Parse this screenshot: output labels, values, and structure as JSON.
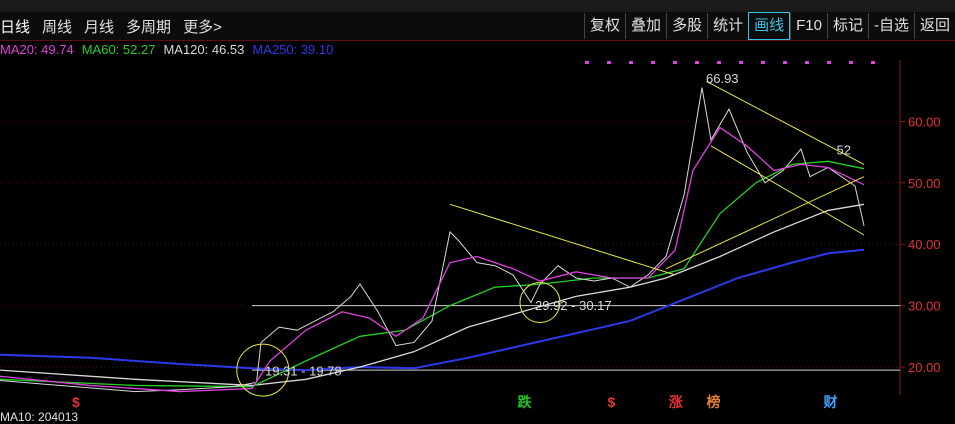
{
  "toolbar": {
    "left_items": [
      "日线",
      "周线",
      "月线",
      "多周期",
      "更多>"
    ],
    "right_items": [
      "复权",
      "叠加",
      "多股",
      "统计",
      "画线",
      "F10",
      "标记",
      "-自选",
      "返回"
    ],
    "active_right": "画线"
  },
  "ma_legend": [
    {
      "label": "MA20: 49.74",
      "color": "#e040e0"
    },
    {
      "label": "MA60: 52.27",
      "color": "#22d022"
    },
    {
      "label": "MA120: 46.53",
      "color": "#d8d8d8"
    },
    {
      "label": "MA250: 39.10",
      "color": "#2a3ae8"
    }
  ],
  "bottom_label": "MA10: 204013",
  "chart_data": {
    "type": "line",
    "y_axis": {
      "ticks": [
        20.0,
        30.0,
        40.0,
        50.0,
        60.0
      ],
      "min": 13,
      "max": 70,
      "side": "right"
    },
    "annotations": [
      {
        "text": "66.93",
        "at": [
          0.78,
          66.93
        ]
      },
      {
        "text": "29.92 - 30.17",
        "at": [
          0.59,
          29.92
        ]
      },
      {
        "text": "19.31 - 19.78",
        "at": [
          0.29,
          19.31
        ]
      },
      {
        "text": "52",
        "at": [
          0.925,
          55.3
        ]
      }
    ],
    "horizontal_lines": [
      19.5,
      30.0
    ],
    "event_markers": [
      {
        "text": "$",
        "pos": 0.08,
        "color": "#e83030"
      },
      {
        "text": "跌",
        "pos": 0.575,
        "color": "#22c422"
      },
      {
        "text": "$",
        "pos": 0.675,
        "color": "#e83030"
      },
      {
        "text": "涨",
        "pos": 0.743,
        "color": "#e83030"
      },
      {
        "text": "榜",
        "pos": 0.785,
        "color": "#e08030"
      },
      {
        "text": "财",
        "pos": 0.915,
        "color": "#3aa0ff"
      }
    ],
    "colors": {
      "axis": "#8b1a1a",
      "tick_label": "#e03030",
      "ma20": "#e040e0",
      "ma60": "#22d022",
      "ma120": "#d8d8d8",
      "ma250": "#2a3ae8",
      "trend": "#e8e840",
      "price": "#d8d8d8"
    },
    "price_path": [
      [
        0,
        17.8
      ],
      [
        0.05,
        17.2
      ],
      [
        0.1,
        16.6
      ],
      [
        0.15,
        16.0
      ],
      [
        0.2,
        16.3
      ],
      [
        0.26,
        16.8
      ],
      [
        0.285,
        17.5
      ],
      [
        0.29,
        24.0
      ],
      [
        0.31,
        26.5
      ],
      [
        0.33,
        26.0
      ],
      [
        0.35,
        27.5
      ],
      [
        0.37,
        29.0
      ],
      [
        0.39,
        31.5
      ],
      [
        0.4,
        33.5
      ],
      [
        0.42,
        29.0
      ],
      [
        0.44,
        23.5
      ],
      [
        0.46,
        24.0
      ],
      [
        0.48,
        27.5
      ],
      [
        0.5,
        42.0
      ],
      [
        0.51,
        40.5
      ],
      [
        0.53,
        37.0
      ],
      [
        0.55,
        36.5
      ],
      [
        0.57,
        35.0
      ],
      [
        0.59,
        30.5
      ],
      [
        0.6,
        33.5
      ],
      [
        0.62,
        36.5
      ],
      [
        0.64,
        34.5
      ],
      [
        0.66,
        34.0
      ],
      [
        0.68,
        34.5
      ],
      [
        0.7,
        33.0
      ],
      [
        0.72,
        35.0
      ],
      [
        0.74,
        38.0
      ],
      [
        0.76,
        48.0
      ],
      [
        0.78,
        65.5
      ],
      [
        0.79,
        57.0
      ],
      [
        0.81,
        62.0
      ],
      [
        0.83,
        55.0
      ],
      [
        0.85,
        50.0
      ],
      [
        0.87,
        52.0
      ],
      [
        0.89,
        55.5
      ],
      [
        0.9,
        51.0
      ],
      [
        0.92,
        52.5
      ],
      [
        0.94,
        50.5
      ],
      [
        0.95,
        49.5
      ],
      [
        0.96,
        43.0
      ]
    ],
    "ma20_path": [
      [
        0,
        18.5
      ],
      [
        0.1,
        17.0
      ],
      [
        0.2,
        16.0
      ],
      [
        0.28,
        16.5
      ],
      [
        0.3,
        21.0
      ],
      [
        0.34,
        26.0
      ],
      [
        0.38,
        29.0
      ],
      [
        0.41,
        28.0
      ],
      [
        0.44,
        25.0
      ],
      [
        0.47,
        28.0
      ],
      [
        0.5,
        37.0
      ],
      [
        0.53,
        38.0
      ],
      [
        0.57,
        36.0
      ],
      [
        0.6,
        34.0
      ],
      [
        0.64,
        35.5
      ],
      [
        0.68,
        34.5
      ],
      [
        0.72,
        34.5
      ],
      [
        0.75,
        39.0
      ],
      [
        0.77,
        52.0
      ],
      [
        0.8,
        59.0
      ],
      [
        0.83,
        56.0
      ],
      [
        0.86,
        52.0
      ],
      [
        0.89,
        53.0
      ],
      [
        0.92,
        52.5
      ],
      [
        0.96,
        49.7
      ]
    ],
    "ma60_path": [
      [
        0,
        18.0
      ],
      [
        0.15,
        17.0
      ],
      [
        0.28,
        16.8
      ],
      [
        0.34,
        21.0
      ],
      [
        0.4,
        25.0
      ],
      [
        0.45,
        26.0
      ],
      [
        0.5,
        30.0
      ],
      [
        0.55,
        33.0
      ],
      [
        0.6,
        33.5
      ],
      [
        0.66,
        34.5
      ],
      [
        0.72,
        34.5
      ],
      [
        0.76,
        36.0
      ],
      [
        0.8,
        45.0
      ],
      [
        0.84,
        50.0
      ],
      [
        0.88,
        53.0
      ],
      [
        0.92,
        53.5
      ],
      [
        0.96,
        52.3
      ]
    ],
    "ma120_path": [
      [
        0,
        19.5
      ],
      [
        0.15,
        18.0
      ],
      [
        0.28,
        17.0
      ],
      [
        0.34,
        18.0
      ],
      [
        0.4,
        20.0
      ],
      [
        0.46,
        22.5
      ],
      [
        0.52,
        26.5
      ],
      [
        0.58,
        29.0
      ],
      [
        0.64,
        31.5
      ],
      [
        0.7,
        33.0
      ],
      [
        0.74,
        34.5
      ],
      [
        0.8,
        38.0
      ],
      [
        0.86,
        42.0
      ],
      [
        0.92,
        45.5
      ],
      [
        0.96,
        46.5
      ]
    ],
    "ma250_path": [
      [
        0,
        22.0
      ],
      [
        0.1,
        21.5
      ],
      [
        0.2,
        20.5
      ],
      [
        0.28,
        19.8
      ],
      [
        0.34,
        19.5
      ],
      [
        0.4,
        20.0
      ],
      [
        0.46,
        19.8
      ],
      [
        0.52,
        21.5
      ],
      [
        0.58,
        23.5
      ],
      [
        0.64,
        25.5
      ],
      [
        0.7,
        27.5
      ],
      [
        0.76,
        31.0
      ],
      [
        0.82,
        34.5
      ],
      [
        0.88,
        37.0
      ],
      [
        0.92,
        38.5
      ],
      [
        0.96,
        39.1
      ]
    ]
  }
}
